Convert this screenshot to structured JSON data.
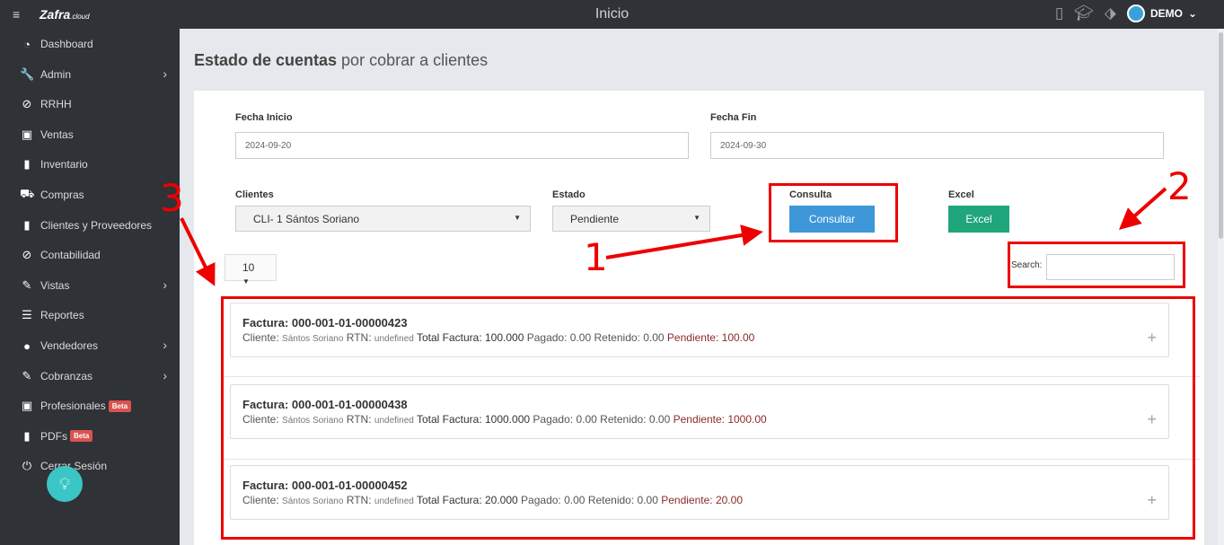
{
  "topbar": {
    "menu_icon": "≡",
    "logo_text": "Zafra",
    "logo_suffix": ".cloud",
    "title": "Inicio",
    "user_name": "DEMO"
  },
  "sidebar": {
    "items": [
      {
        "icon": "dashboard-icon",
        "glyph": "◔",
        "label": "Dashboard",
        "has_chevron": false
      },
      {
        "icon": "wrench-icon",
        "glyph": "🔧",
        "label": "Admin",
        "has_chevron": true
      },
      {
        "icon": "paperclip-icon",
        "glyph": "⊘",
        "label": "RRHH",
        "has_chevron": false
      },
      {
        "icon": "money-icon",
        "glyph": "▣",
        "label": "Ventas",
        "has_chevron": false
      },
      {
        "icon": "book-icon",
        "glyph": "▮",
        "label": "Inventario",
        "has_chevron": false
      },
      {
        "icon": "cart-icon",
        "glyph": "⛟",
        "label": "Compras",
        "has_chevron": false
      },
      {
        "icon": "book-icon",
        "glyph": "▮",
        "label": "Clientes y Proveedores",
        "has_chevron": false
      },
      {
        "icon": "paperclip-icon",
        "glyph": "⊘",
        "label": "Contabilidad",
        "has_chevron": false
      },
      {
        "icon": "edit-icon",
        "glyph": "✎",
        "label": "Vistas",
        "has_chevron": true
      },
      {
        "icon": "list-icon",
        "glyph": "☰",
        "label": "Reportes",
        "has_chevron": false
      },
      {
        "icon": "user-icon",
        "glyph": "●",
        "label": "Vendedores",
        "has_chevron": true
      },
      {
        "icon": "edit-icon",
        "glyph": "✎",
        "label": "Cobranzas",
        "has_chevron": true
      },
      {
        "icon": "money-icon",
        "glyph": "▣",
        "label": "Profesionales",
        "has_chevron": false,
        "badge": "Beta"
      },
      {
        "icon": "book-icon",
        "glyph": "▮",
        "label": "PDFs",
        "has_chevron": false,
        "badge": "Beta"
      },
      {
        "icon": "power-icon",
        "glyph": "⏻",
        "label": "Cerrar Sesión",
        "has_chevron": false
      }
    ]
  },
  "page": {
    "title_bold": "Estado de cuentas",
    "title_rest": " por cobrar a clientes"
  },
  "filters": {
    "fecha_inicio_label": "Fecha Inicio",
    "fecha_inicio_value": "2024-09-20",
    "fecha_fin_label": "Fecha Fin",
    "fecha_fin_value": "2024-09-30",
    "clientes_label": "Clientes",
    "clientes_value": "CLI- 1 Sántos Soriano",
    "estado_label": "Estado",
    "estado_value": "Pendiente",
    "consulta_label": "Consulta",
    "consultar_button": "Consultar",
    "excel_label": "Excel",
    "excel_button": "Excel"
  },
  "table": {
    "page_length": "10",
    "search_label": "Search:",
    "invoices": [
      {
        "factura_label": "Factura:",
        "factura_num": "000-001-01-00000423",
        "cliente_label": "Cliente:",
        "cliente": "Sántos Soriano",
        "rtn_label": "RTN:",
        "rtn": "undefined",
        "total_label": "Total Factura:",
        "total": "100.000",
        "pagado_label": "Pagado:",
        "pagado": "0.00",
        "retenido_label": "Retenido:",
        "retenido": "0.00",
        "pendiente_label": "Pendiente:",
        "pendiente": "100.00"
      },
      {
        "factura_label": "Factura:",
        "factura_num": "000-001-01-00000438",
        "cliente_label": "Cliente:",
        "cliente": "Sántos Soriano",
        "rtn_label": "RTN:",
        "rtn": "undefined",
        "total_label": "Total Factura:",
        "total": "1000.000",
        "pagado_label": "Pagado:",
        "pagado": "0.00",
        "retenido_label": "Retenido:",
        "retenido": "0.00",
        "pendiente_label": "Pendiente:",
        "pendiente": "1000.00"
      },
      {
        "factura_label": "Factura:",
        "factura_num": "000-001-01-00000452",
        "cliente_label": "Cliente:",
        "cliente": "Sántos Soriano",
        "rtn_label": "RTN:",
        "rtn": "undefined",
        "total_label": "Total Factura:",
        "total": "20.000",
        "pagado_label": "Pagado:",
        "pagado": "0.00",
        "retenido_label": "Retenido:",
        "retenido": "0.00",
        "pendiente_label": "Pendiente:",
        "pendiente": "20.00"
      }
    ]
  },
  "annotations": {
    "one": "1",
    "two": "2",
    "three": "3",
    "color": "#ee0000"
  },
  "colors": {
    "sidebar_bg": "#2f3237",
    "primary_button": "#3d97d9",
    "excel_button": "#1fa67a",
    "pending_text": "#8a2a2a",
    "badge": "#d9534f"
  }
}
